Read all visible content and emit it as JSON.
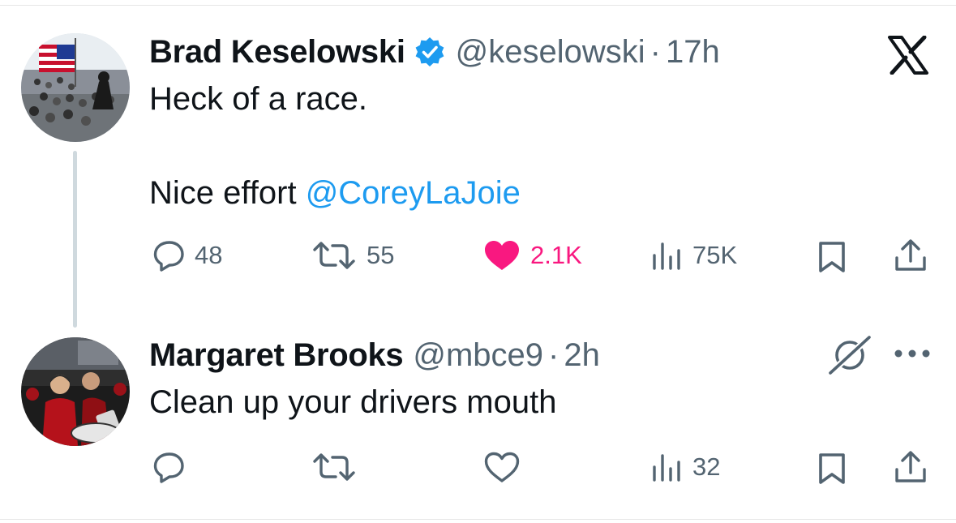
{
  "tweet": {
    "author": {
      "name": "Brad Keselowski",
      "handle": "@keselowski",
      "time": "17h",
      "verified": true
    },
    "text_line1": "Heck of a race.",
    "text_line2_prefix": "Nice effort ",
    "mention": "@CoreyLaJoie",
    "stats": {
      "replies": "48",
      "reposts": "55",
      "likes": "2.1K",
      "views": "75K"
    },
    "liked": true
  },
  "reply": {
    "author": {
      "name": "Margaret Brooks",
      "handle": "@mbce9",
      "time": "2h"
    },
    "text": "Clean up your drivers mouth",
    "stats": {
      "views": "32"
    }
  },
  "icons": {
    "brand": "x-logo-icon",
    "verified": "verified-badge-icon",
    "reply": "reply-bubble-icon",
    "repost": "repost-icon",
    "like": "heart-icon",
    "views": "views-bar-chart-icon",
    "bookmark": "bookmark-icon",
    "share": "share-upload-icon",
    "grok": "grok-icon",
    "more": "more-dots-icon"
  },
  "colors": {
    "text": "#0f1419",
    "secondary": "#536471",
    "accent": "#1d9bf0",
    "like": "#f91880",
    "thread_line": "#cfd9de"
  },
  "separator": "·"
}
